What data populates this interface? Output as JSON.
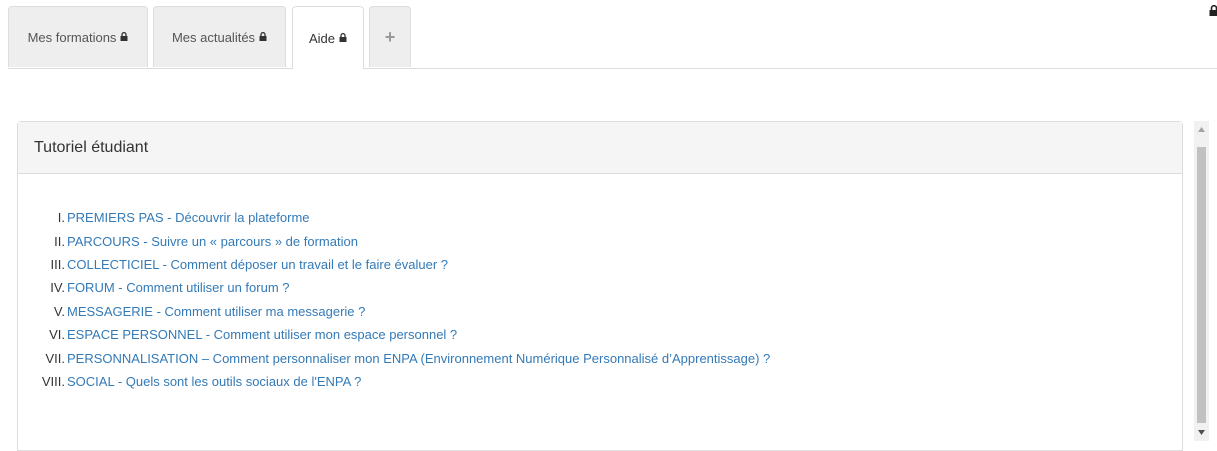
{
  "tabs": [
    {
      "label": "Mes formations",
      "locked": true,
      "active": false
    },
    {
      "label": "Mes actualités",
      "locked": true,
      "active": false
    },
    {
      "label": "Aide",
      "locked": true,
      "active": true
    },
    {
      "label": "+",
      "add": true
    }
  ],
  "panel": {
    "title": "Tutoriel étudiant",
    "items": [
      {
        "num": "I.",
        "text": "PREMIERS PAS - Découvrir la plateforme"
      },
      {
        "num": "II.",
        "text": "PARCOURS - Suivre un « parcours » de formation"
      },
      {
        "num": "III.",
        "text": "COLLECTICIEL - Comment déposer un travail et le faire évaluer ?"
      },
      {
        "num": "IV.",
        "text": "FORUM - Comment utiliser un forum ?"
      },
      {
        "num": "V.",
        "text": "MESSAGERIE - Comment utiliser ma messagerie ?"
      },
      {
        "num": "VI.",
        "text": "ESPACE PERSONNEL - Comment utiliser mon espace personnel ?"
      },
      {
        "num": "VII.",
        "text": "PERSONNALISATION – Comment personnaliser mon ENPA (Environnement Numérique Personnalisé d’Apprentissage) ?"
      },
      {
        "num": "VIII.",
        "text": "SOCIAL - Quels sont les outils sociaux de l'ENPA ?"
      }
    ]
  },
  "colors": {
    "link": "#337ab7",
    "tab_bg": "#eeeeee",
    "heading_bg": "#f5f5f5"
  },
  "icons": {
    "tab_lock": "lock-icon",
    "corner": "lock-icon",
    "scroll_up": "triangle-up-icon",
    "scroll_down": "triangle-down-icon"
  }
}
